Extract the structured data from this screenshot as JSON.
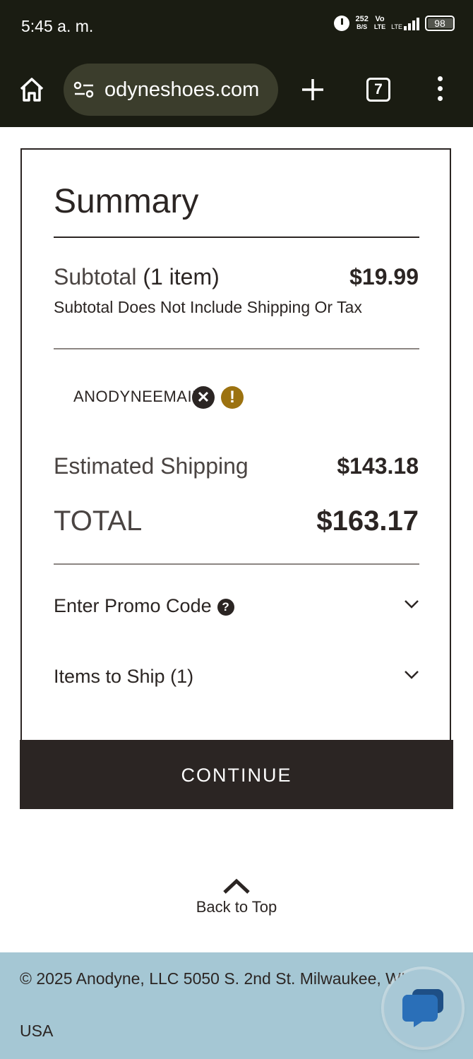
{
  "status_bar": {
    "time": "5:45 a. m.",
    "net_speed_value": "252",
    "net_speed_unit": "B/S",
    "volte_top": "Vo",
    "volte_bottom": "LTE",
    "network": "LTE",
    "battery": "98"
  },
  "browser": {
    "url": "odyneshoes.com",
    "tab_count": "7"
  },
  "summary": {
    "title": "Summary",
    "subtotal_label": "Subtotal",
    "subtotal_items": "(1 item)",
    "subtotal_value": "$19.99",
    "subtotal_note": "Subtotal Does Not Include Shipping Or Tax",
    "applied_code": "ANODYNEEMAIL",
    "shipping_label": "Estimated Shipping",
    "shipping_value": "$143.18",
    "total_label": "TOTAL",
    "total_value": "$163.17",
    "promo_label": "Enter Promo Code",
    "items_to_ship_label": "Items to Ship (1)",
    "continue_label": "CONTINUE"
  },
  "back_to_top": "Back to Top",
  "footer": {
    "copyright": "© 2025 Anodyne, LLC 5050 S. 2nd St. Milwaukee, WI 53207",
    "country": "USA"
  },
  "colors": {
    "primary_dark": "#2b2523",
    "warning": "#9c7210",
    "footer_bg": "#a5c7d4",
    "chrome_bg": "#1a1c12"
  }
}
